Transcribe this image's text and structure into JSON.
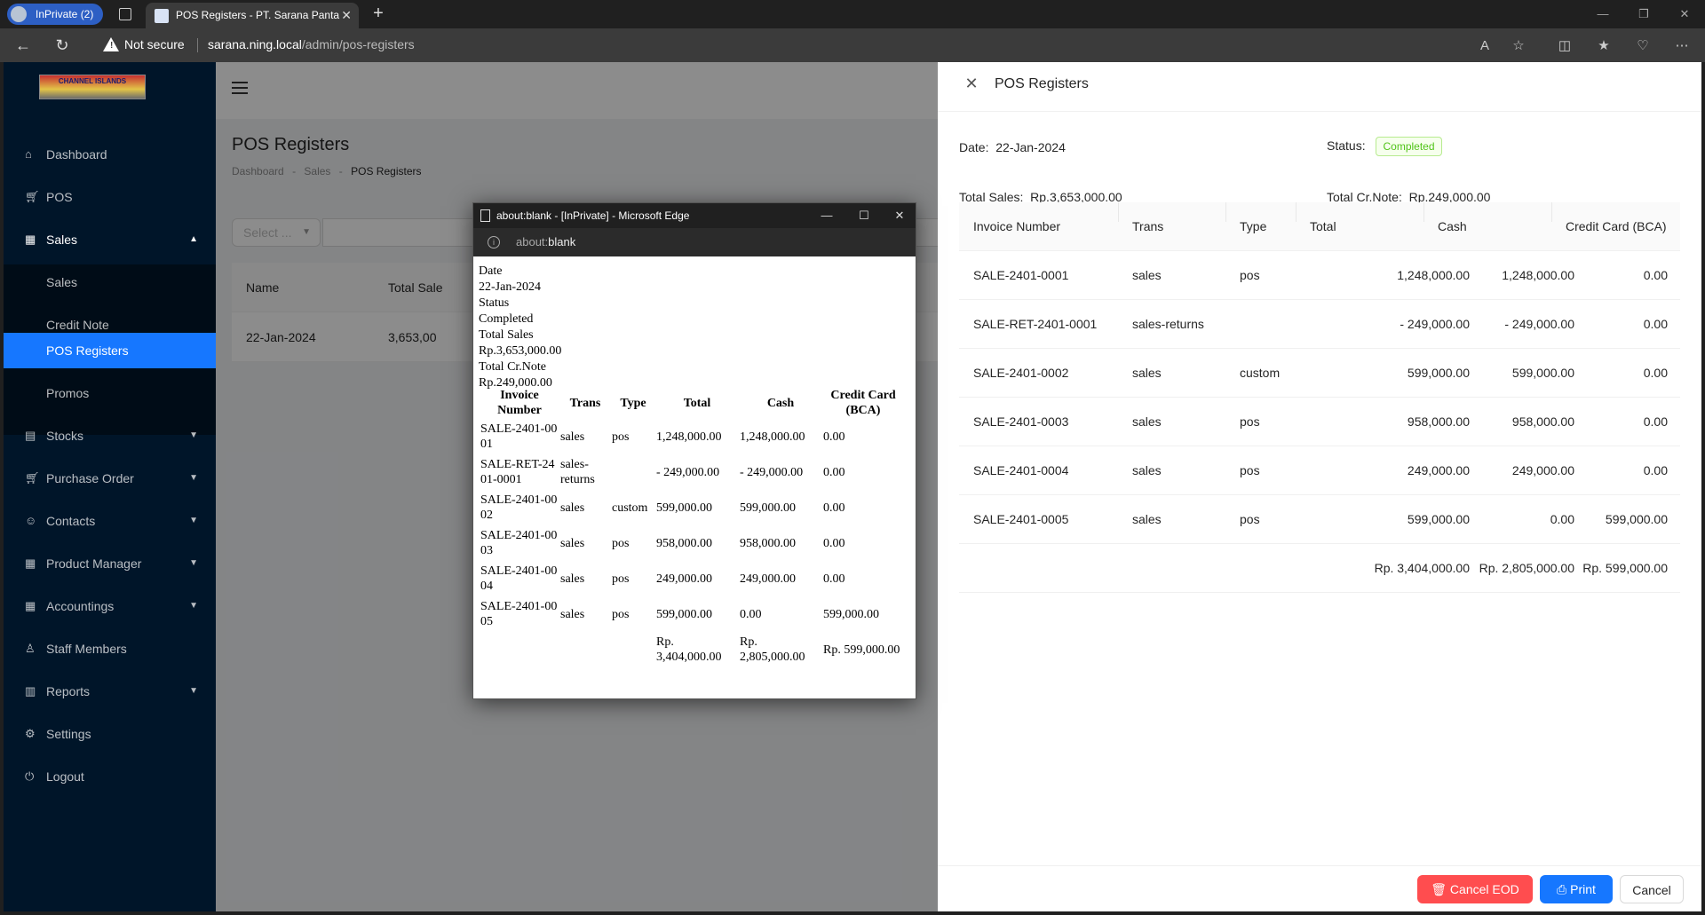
{
  "browser": {
    "profile_label": "InPrivate (2)",
    "tab_title": "POS Registers - PT. Sarana Panta",
    "security_label": "Not secure",
    "url_host": "sarana.ning.local",
    "url_path": "/admin/pos-registers"
  },
  "sidebar": {
    "logo_text": "CHANNEL ISLANDS",
    "items": [
      {
        "label": "Dashboard",
        "icon": "dashboard-icon"
      },
      {
        "label": "POS",
        "icon": "cart-icon"
      },
      {
        "label": "Sales",
        "icon": "table-icon"
      },
      {
        "label": "Stocks",
        "icon": "box-icon"
      },
      {
        "label": "Purchase Order",
        "icon": "cart-icon"
      },
      {
        "label": "Contacts",
        "icon": "contacts-icon"
      },
      {
        "label": "Product Manager",
        "icon": "grid-icon"
      },
      {
        "label": "Accountings",
        "icon": "grid-icon"
      },
      {
        "label": "Staff Members",
        "icon": "user-icon"
      },
      {
        "label": "Reports",
        "icon": "chart-icon"
      },
      {
        "label": "Settings",
        "icon": "gear-icon"
      },
      {
        "label": "Logout",
        "icon": "logout-icon"
      }
    ],
    "sales_sub": [
      "Sales",
      "Credit Note",
      "POS Registers",
      "Promos"
    ]
  },
  "main": {
    "title": "POS Registers",
    "breadcrumb": [
      "Dashboard",
      "Sales",
      "POS Registers"
    ],
    "select_placeholder": "Select ...",
    "columns": [
      "Name",
      "Total Sale"
    ],
    "row": {
      "name": "22-Jan-2024",
      "total": "3,653,00"
    }
  },
  "drawer": {
    "title": "POS Registers",
    "date_label": "Date",
    "date_value": "22-Jan-2024",
    "status_label": "Status",
    "status_value": "Completed",
    "total_sales_label": "Total Sales",
    "total_sales_value": "Rp.3,653,000.00",
    "total_crnote_label": "Total Cr.Note",
    "total_crnote_value": "Rp.249,000.00",
    "columns": [
      "Invoice Number",
      "Trans",
      "Type",
      "Total",
      "Cash",
      "Credit Card (BCA)"
    ],
    "rows": [
      {
        "invoice": "SALE-2401-0001",
        "trans": "sales",
        "type": "pos",
        "total": "1,248,000.00",
        "cash": "1,248,000.00",
        "cc": "0.00"
      },
      {
        "invoice": "SALE-RET-2401-0001",
        "trans": "sales-returns",
        "type": "",
        "total": "- 249,000.00",
        "cash": "- 249,000.00",
        "cc": "0.00"
      },
      {
        "invoice": "SALE-2401-0002",
        "trans": "sales",
        "type": "custom",
        "total": "599,000.00",
        "cash": "599,000.00",
        "cc": "0.00"
      },
      {
        "invoice": "SALE-2401-0003",
        "trans": "sales",
        "type": "pos",
        "total": "958,000.00",
        "cash": "958,000.00",
        "cc": "0.00"
      },
      {
        "invoice": "SALE-2401-0004",
        "trans": "sales",
        "type": "pos",
        "total": "249,000.00",
        "cash": "249,000.00",
        "cc": "0.00"
      },
      {
        "invoice": "SALE-2401-0005",
        "trans": "sales",
        "type": "pos",
        "total": "599,000.00",
        "cash": "0.00",
        "cc": "599,000.00"
      }
    ],
    "totals": {
      "total": "Rp. 3,404,000.00",
      "cash": "Rp. 2,805,000.00",
      "cc": "Rp. 599,000.00"
    },
    "buttons": {
      "cancel_eod": "Cancel EOD",
      "print": "Print",
      "cancel": "Cancel"
    }
  },
  "popup": {
    "window_title": "about:blank - [InPrivate] - Microsoft Edge",
    "address_prefix": "about:",
    "address_host": "blank",
    "lines": [
      "Date",
      "22-Jan-2024",
      "Status",
      "Completed",
      "Total Sales",
      "Rp.3,653,000.00",
      "Total Cr.Note",
      "Rp.249,000.00"
    ],
    "columns": [
      "Invoice Number",
      "Trans",
      "Type",
      "Total",
      "Cash",
      "Credit Card (BCA)"
    ],
    "totals": {
      "total": "Rp. 3,404,000.00",
      "cash": "Rp. 2,805,000.00",
      "cc": "Rp. 599,000.00"
    }
  },
  "colors": {
    "sidebar_bg": "#001529",
    "active_item": "#1677ff",
    "danger": "#ff4d4f",
    "success_tag": "#52c41a"
  }
}
